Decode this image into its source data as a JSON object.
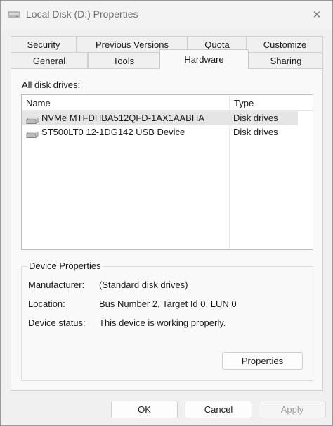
{
  "window": {
    "title": "Local Disk (D:) Properties",
    "close_glyph": "✕"
  },
  "tabs": {
    "row_back": [
      "Security",
      "Previous Versions",
      "Quota",
      "Customize"
    ],
    "row_front": [
      "General",
      "Tools",
      "Hardware",
      "Sharing"
    ],
    "active": "Hardware"
  },
  "hardware": {
    "list_label": "All disk drives:",
    "columns": {
      "name": "Name",
      "type": "Type"
    },
    "drives": [
      {
        "name": "NVMe MTFDHBA512QFD-1AX1AABHA",
        "type": "Disk drives",
        "selected": true
      },
      {
        "name": "ST500LT0 12-1DG142 USB Device",
        "type": "Disk drives",
        "selected": false
      }
    ]
  },
  "device_properties": {
    "title": "Device Properties",
    "manufacturer_label": "Manufacturer:",
    "manufacturer_value": "(Standard disk drives)",
    "location_label": "Location:",
    "location_value": "Bus Number 2, Target Id 0, LUN 0",
    "status_label": "Device status:",
    "status_value": "This device is working properly.",
    "properties_button": "Properties"
  },
  "buttons": {
    "ok": "OK",
    "cancel": "Cancel",
    "apply": "Apply"
  },
  "colors": {
    "selected_row": "#e5e5e5",
    "window_bg": "#f0f0f0",
    "panel_bg": "#f9f9f9"
  }
}
